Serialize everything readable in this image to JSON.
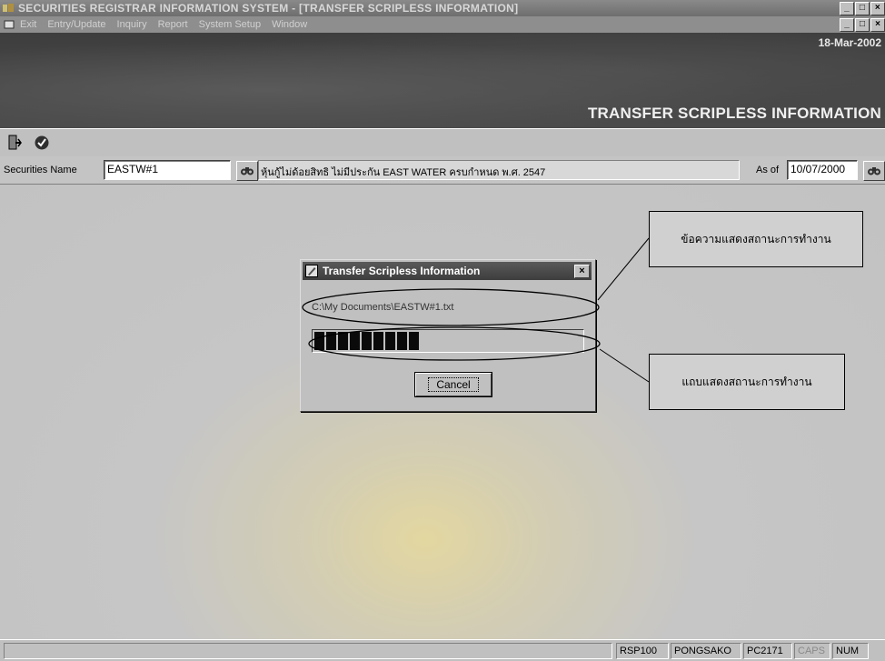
{
  "window": {
    "title": "SECURITIES REGISTRAR INFORMATION SYSTEM - [TRANSFER SCRIPLESS INFORMATION]",
    "controls": {
      "minimize": "_",
      "maximize": "□",
      "close": "×"
    }
  },
  "menu": {
    "items": [
      "Exit",
      "Entry/Update",
      "Inquiry",
      "Report",
      "System Setup",
      "Window"
    ]
  },
  "banner": {
    "date": "18-Mar-2002",
    "title": "TRANSFER SCRIPLESS INFORMATION"
  },
  "toolbar": {
    "icons": [
      "exit-door-icon",
      "check-icon"
    ]
  },
  "securities": {
    "label": "Securities Name",
    "value": "EASTW#1",
    "description": "หุ้นกู้ไม่ด้อยสิทธิ ไม่มีประกัน EAST WATER ครบกำหนด พ.ศ. 2547",
    "as_of_label": "As of",
    "as_of_value": "10/07/2000"
  },
  "dialog": {
    "title": "Transfer Scripless Information",
    "file_path": "C:\\My Documents\\EASTW#1.txt",
    "progress_blocks": 9,
    "cancel_label": "Cancel"
  },
  "callouts": {
    "status_message": "ข้อความแสดงสถานะการทำงาน",
    "status_bar": "แถบแสดงสถานะการทำงาน"
  },
  "statusbar": {
    "cells": [
      "RSP100",
      "PONGSAKO",
      "PC2171",
      "CAPS",
      "NUM"
    ]
  },
  "colors": {
    "titlebar": "#6e6e6e",
    "banner": "#454545",
    "workspace": "#c4c4c4",
    "dialog_title": "#4a4a4a"
  }
}
